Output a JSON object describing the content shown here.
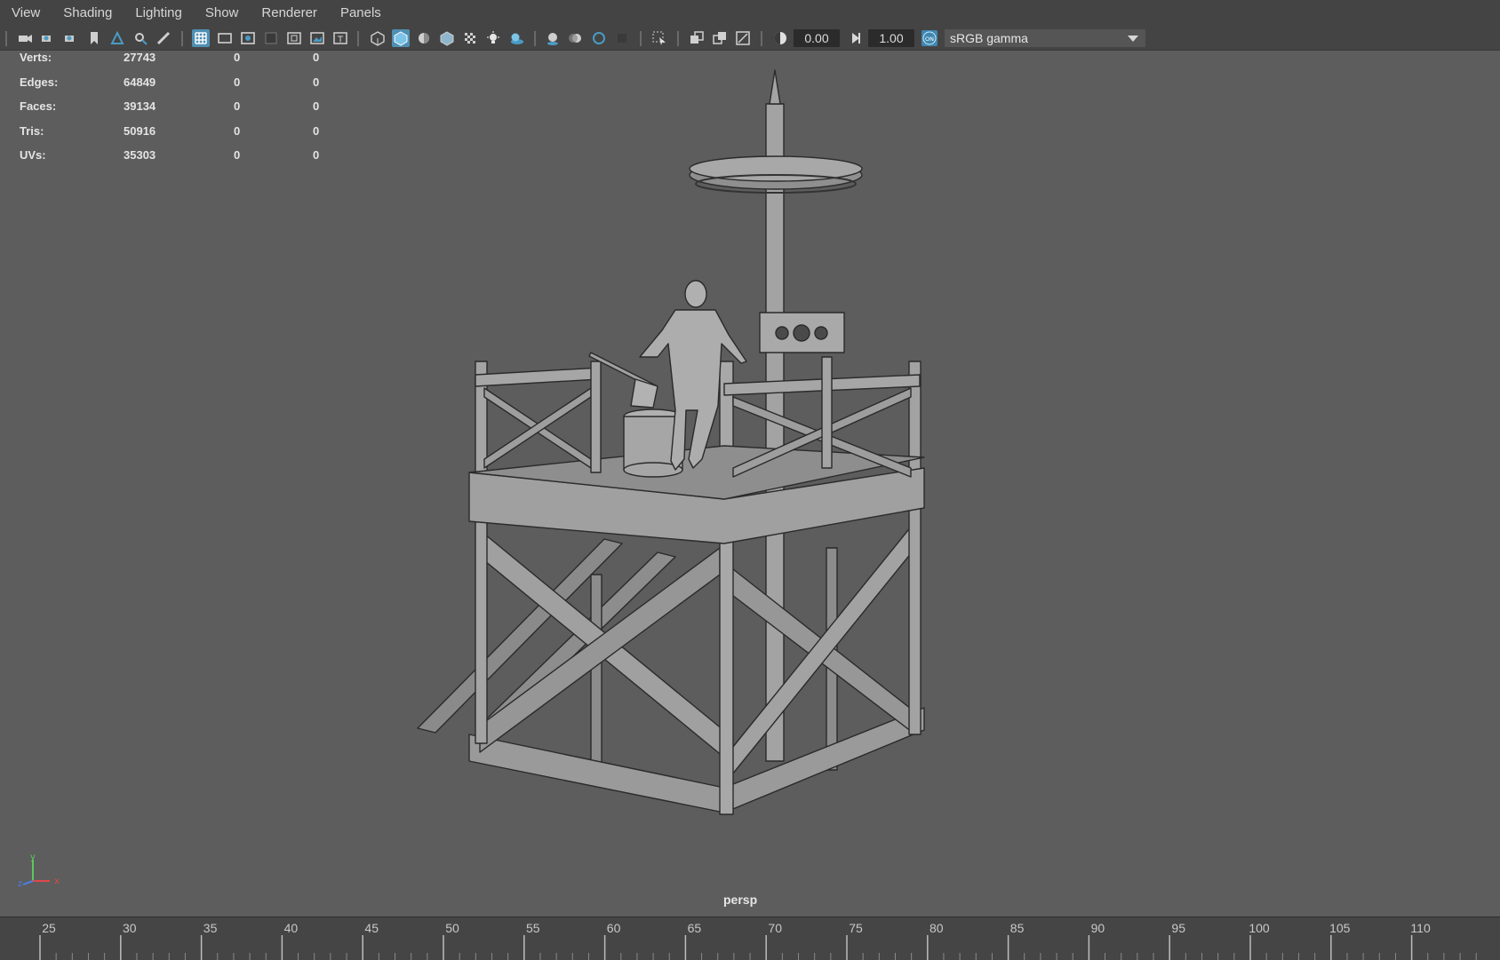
{
  "menubar": {
    "items": [
      "View",
      "Shading",
      "Lighting",
      "Show",
      "Renderer",
      "Panels"
    ]
  },
  "toolbar": {
    "exposure_value": "0.00",
    "gamma_value": "1.00",
    "colorspace_toggle": "ON",
    "colorspace": "sRGB gamma",
    "icons": [
      "camera-select-icon",
      "camera-attributes-icon",
      "bookmark-icon",
      "image-plane-icon",
      "grid-icon",
      "film-gate-icon",
      "resolution-gate-icon",
      "gate-mask-icon",
      "field-chart-icon",
      "safe-action-icon",
      "safe-title-icon",
      "wireframe-icon",
      "smooth-shade-icon",
      "default-material-icon",
      "wireframe-on-shaded-icon",
      "textured-icon",
      "use-all-lights-icon",
      "shadows-icon",
      "screen-space-ao-icon",
      "motion-blur-icon",
      "anti-aliasing-icon",
      "depth-of-field-icon",
      "isolate-select-icon",
      "xray-icon",
      "xray-active-icon",
      "xray-joints-icon",
      "exposure-icon",
      "gamma-icon"
    ]
  },
  "hud": {
    "rows": [
      {
        "label": "Verts:",
        "v1": "27743",
        "v2": "0",
        "v3": "0"
      },
      {
        "label": "Edges:",
        "v1": "64849",
        "v2": "0",
        "v3": "0"
      },
      {
        "label": "Faces:",
        "v1": "39134",
        "v2": "0",
        "v3": "0"
      },
      {
        "label": "Tris:",
        "v1": "50916",
        "v2": "0",
        "v3": "0"
      },
      {
        "label": "UVs:",
        "v1": "35303",
        "v2": "0",
        "v3": "0"
      }
    ]
  },
  "viewport": {
    "camera_label": "persp",
    "axis": {
      "y": "y",
      "x": "x",
      "z": "z"
    }
  },
  "timeline": {
    "ticks": [
      "25",
      "30",
      "35",
      "40",
      "45",
      "50",
      "55",
      "60",
      "65",
      "70",
      "75",
      "80",
      "85",
      "90",
      "95",
      "100",
      "105",
      "110"
    ]
  },
  "colors": {
    "ui_bg": "#444444",
    "viewport_bg": "#5d5d5d",
    "active_icon": "#4f8fb3",
    "model": "#9a9a9a"
  }
}
